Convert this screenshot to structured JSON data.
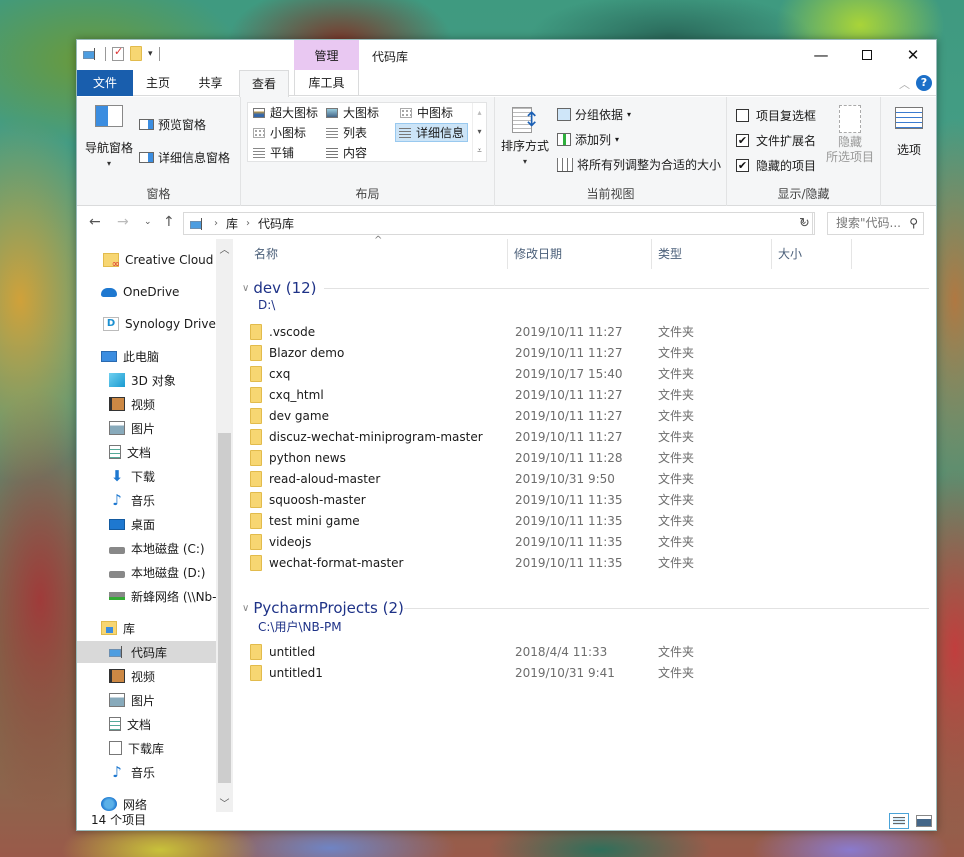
{
  "window": {
    "title": "代码库",
    "contextual_tab_group": "管理",
    "controls": {
      "minimize": "—",
      "maximize": "",
      "close": "✕"
    },
    "help_label": "?"
  },
  "ribbon_tabs": {
    "file": "文件",
    "home": "主页",
    "share": "共享",
    "view": "查看",
    "library_tools": "库工具",
    "active": "查看"
  },
  "ribbon": {
    "panes": {
      "label": "窗格",
      "navigation_pane": "导航窗格",
      "preview_pane": "预览窗格",
      "details_pane": "详细信息窗格"
    },
    "layout": {
      "label": "布局",
      "options": [
        "超大图标",
        "大图标",
        "中图标",
        "小图标",
        "列表",
        "详细信息",
        "平铺",
        "内容"
      ],
      "selected": "详细信息"
    },
    "current_view": {
      "label": "当前视图",
      "sort_by": "排序方式",
      "group_by": "分组依据",
      "add_columns": "添加列",
      "size_all_columns": "将所有列调整为合适的大小"
    },
    "show_hide": {
      "label": "显示/隐藏",
      "item_checkboxes": {
        "label": "项目复选框",
        "checked": false
      },
      "file_name_extensions": {
        "label": "文件扩展名",
        "checked": true
      },
      "hidden_items": {
        "label": "隐藏的项目",
        "checked": true
      },
      "hide_selected_line1": "隐藏",
      "hide_selected_line2": "所选项目"
    },
    "options": {
      "label": "选项"
    }
  },
  "address_bar": {
    "breadcrumb": [
      "库",
      "代码库"
    ],
    "search_placeholder": "搜索\"代码..."
  },
  "nav_pane": {
    "items": [
      {
        "label": "Creative Cloud F",
        "icon": "creative-cloud-folder-icon"
      },
      {
        "label": "OneDrive",
        "icon": "onedrive-cloud-icon"
      },
      {
        "label": "Synology Drive -",
        "icon": "synology-drive-icon"
      },
      {
        "label": "此电脑",
        "icon": "this-pc-icon"
      },
      {
        "label": "3D 对象",
        "icon": "3d-objects-icon"
      },
      {
        "label": "视频",
        "icon": "videos-icon"
      },
      {
        "label": "图片",
        "icon": "pictures-icon"
      },
      {
        "label": "文档",
        "icon": "documents-icon"
      },
      {
        "label": "下载",
        "icon": "downloads-icon"
      },
      {
        "label": "音乐",
        "icon": "music-icon"
      },
      {
        "label": "桌面",
        "icon": "desktop-icon"
      },
      {
        "label": "本地磁盘 (C:)",
        "icon": "local-disk-c-icon"
      },
      {
        "label": "本地磁盘 (D:)",
        "icon": "local-disk-d-icon"
      },
      {
        "label": "新蜂网络 (\\\\Nb-",
        "icon": "network-drive-icon"
      },
      {
        "label": "库",
        "icon": "libraries-icon"
      },
      {
        "label": "代码库",
        "icon": "code-library-icon",
        "selected": true
      },
      {
        "label": "视频",
        "icon": "videos-library-icon"
      },
      {
        "label": "图片",
        "icon": "pictures-library-icon"
      },
      {
        "label": "文档",
        "icon": "documents-library-icon"
      },
      {
        "label": "下载库",
        "icon": "downloads-library-icon"
      },
      {
        "label": "音乐",
        "icon": "music-library-icon"
      },
      {
        "label": "网络",
        "icon": "network-icon"
      }
    ]
  },
  "columns": {
    "name": "名称",
    "modified": "修改日期",
    "type": "类型",
    "size": "大小"
  },
  "groups": [
    {
      "title": "dev (12)",
      "path": "D:\\",
      "files": [
        {
          "name": ".vscode",
          "modified": "2019/10/11 11:27",
          "type": "文件夹"
        },
        {
          "name": "Blazor demo",
          "modified": "2019/10/11 11:27",
          "type": "文件夹"
        },
        {
          "name": "cxq",
          "modified": "2019/10/17 15:40",
          "type": "文件夹"
        },
        {
          "name": "cxq_html",
          "modified": "2019/10/11 11:27",
          "type": "文件夹"
        },
        {
          "name": "dev game",
          "modified": "2019/10/11 11:27",
          "type": "文件夹"
        },
        {
          "name": "discuz-wechat-miniprogram-master",
          "modified": "2019/10/11 11:27",
          "type": "文件夹"
        },
        {
          "name": "python news",
          "modified": "2019/10/11 11:28",
          "type": "文件夹"
        },
        {
          "name": "read-aloud-master",
          "modified": "2019/10/31 9:50",
          "type": "文件夹"
        },
        {
          "name": "squoosh-master",
          "modified": "2019/10/11 11:35",
          "type": "文件夹"
        },
        {
          "name": "test mini game",
          "modified": "2019/10/11 11:35",
          "type": "文件夹"
        },
        {
          "name": "videojs",
          "modified": "2019/10/11 11:35",
          "type": "文件夹"
        },
        {
          "name": "wechat-format-master",
          "modified": "2019/10/11 11:35",
          "type": "文件夹"
        }
      ]
    },
    {
      "title": "PycharmProjects (2)",
      "path": "C:\\用户\\NB-PM",
      "files": [
        {
          "name": "untitled",
          "modified": "2018/4/4 11:33",
          "type": "文件夹"
        },
        {
          "name": "untitled1",
          "modified": "2019/10/31 9:41",
          "type": "文件夹"
        }
      ]
    }
  ],
  "status_bar": {
    "item_count": "14 个项目"
  },
  "colors": {
    "file_tab": "#195ead",
    "contextual_tab": "#e9c8f2",
    "group_header": "#1e3287",
    "selection": "#cce4f7",
    "folder": "#f7d672"
  }
}
